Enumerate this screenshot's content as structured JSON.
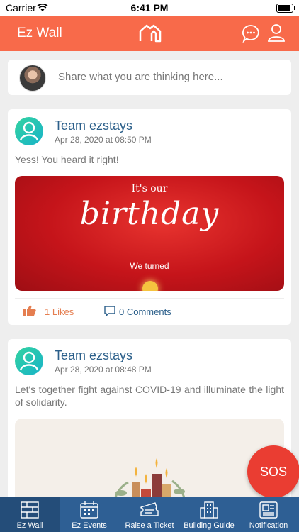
{
  "status_bar": {
    "carrier": "Carrier",
    "time": "6:41 PM"
  },
  "header": {
    "title": "Ez Wall"
  },
  "share": {
    "placeholder": "Share what you are thinking here..."
  },
  "posts": [
    {
      "author": "Team ezstays",
      "date": "Apr 28, 2020 at 08:50 PM",
      "text": "Yess! You heard it right!",
      "banner_line1": "It's our",
      "banner_line2": "birthday",
      "banner_line3": "We turned",
      "likes": "1 Likes",
      "comments": "0 Comments"
    },
    {
      "author": "Team ezstays",
      "date": "Apr 28, 2020 at 08:48 PM",
      "text": "Let's together fight against COVID-19 and illuminate the light of solidarity."
    }
  ],
  "sos_label": "SOS",
  "bottom_nav": [
    {
      "label": "Ez Wall",
      "icon": "wall-icon"
    },
    {
      "label": "Ez Events",
      "icon": "events-icon"
    },
    {
      "label": "Raise a Ticket",
      "icon": "ticket-icon"
    },
    {
      "label": "Building Guide",
      "icon": "building-icon"
    },
    {
      "label": "Notification",
      "icon": "notification-icon"
    }
  ],
  "colors": {
    "accent": "#f86a4a",
    "nav": "#2e5f94",
    "sos": "#ea3d32",
    "author": "#2b5f8a",
    "likes": "#e57e50"
  }
}
